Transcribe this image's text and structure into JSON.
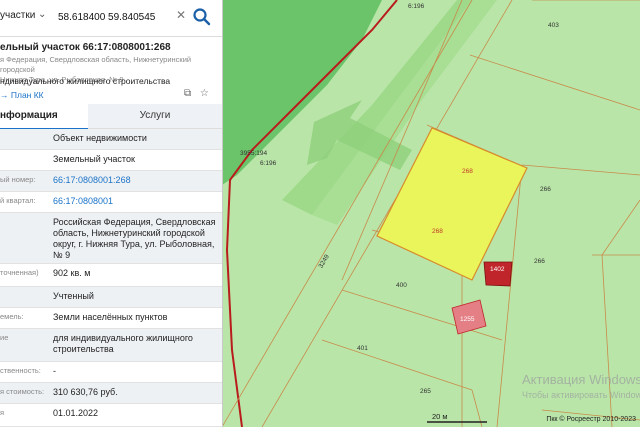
{
  "search": {
    "type_label": "участки",
    "query": "58.618400 59.840545"
  },
  "parcel": {
    "title": "ельный участок 66:17:0808001:268",
    "address_short": "я Федерация, Свердловская область, Нижнетуринский городской\nНижняя Тура, ул. Рыболовная, № 9",
    "purpose_short": "ндивидуального жилищного строительства",
    "plan_link": "План КК"
  },
  "tabs": {
    "info": "нформация",
    "services": "Услуги"
  },
  "info_rows": [
    {
      "key": "",
      "value": "Объект недвижимости",
      "link": false
    },
    {
      "key": "",
      "value": "Земельный участок",
      "link": false
    },
    {
      "key": "ый номер:",
      "value": "66:17:0808001:268",
      "link": true
    },
    {
      "key": "й квартал:",
      "value": "66:17:0808001",
      "link": true
    },
    {
      "key": "",
      "value": "Российская Федерация, Свердловская область, Нижнетуринский городской округ, г. Нижняя Тура, ул. Рыболовная, № 9",
      "link": false
    },
    {
      "key": "точненная)",
      "value": "902 кв. м",
      "link": false
    },
    {
      "key": "",
      "value": "Учтенный",
      "link": false
    },
    {
      "key": "емель:",
      "value": "Земли населённых пунктов",
      "link": false
    },
    {
      "key": "ие",
      "value": "для индивидуального жилищного строительства",
      "link": false
    },
    {
      "key": "ственность:",
      "value": "-",
      "link": false
    },
    {
      "key": "я стоимость:",
      "value": "310 630,76 руб.",
      "link": false
    },
    {
      "key": "я",
      "value": "01.01.2022",
      "link": false
    }
  ],
  "map": {
    "parcel_labels": [
      "268",
      "268",
      "266",
      "266",
      "403",
      "400",
      "401",
      "265",
      "1402",
      "1255"
    ],
    "boundary_labels": [
      "6:196",
      "3955:194",
      "6:196",
      "3249"
    ],
    "scale": "20 м",
    "copyright": "Пкк © Росреестр 2010-2023"
  },
  "watermark": {
    "line1": "Активация Windows",
    "line2": "Чтобы активировать Windows, перейдите в раздел \"Параметры\"."
  },
  "colors": {
    "selected_parcel": "#e9f55a",
    "map_bg": "#b9e6a8",
    "road_band": "#8fcf78",
    "building": "#c0252b",
    "accent": "#1a73c8"
  }
}
